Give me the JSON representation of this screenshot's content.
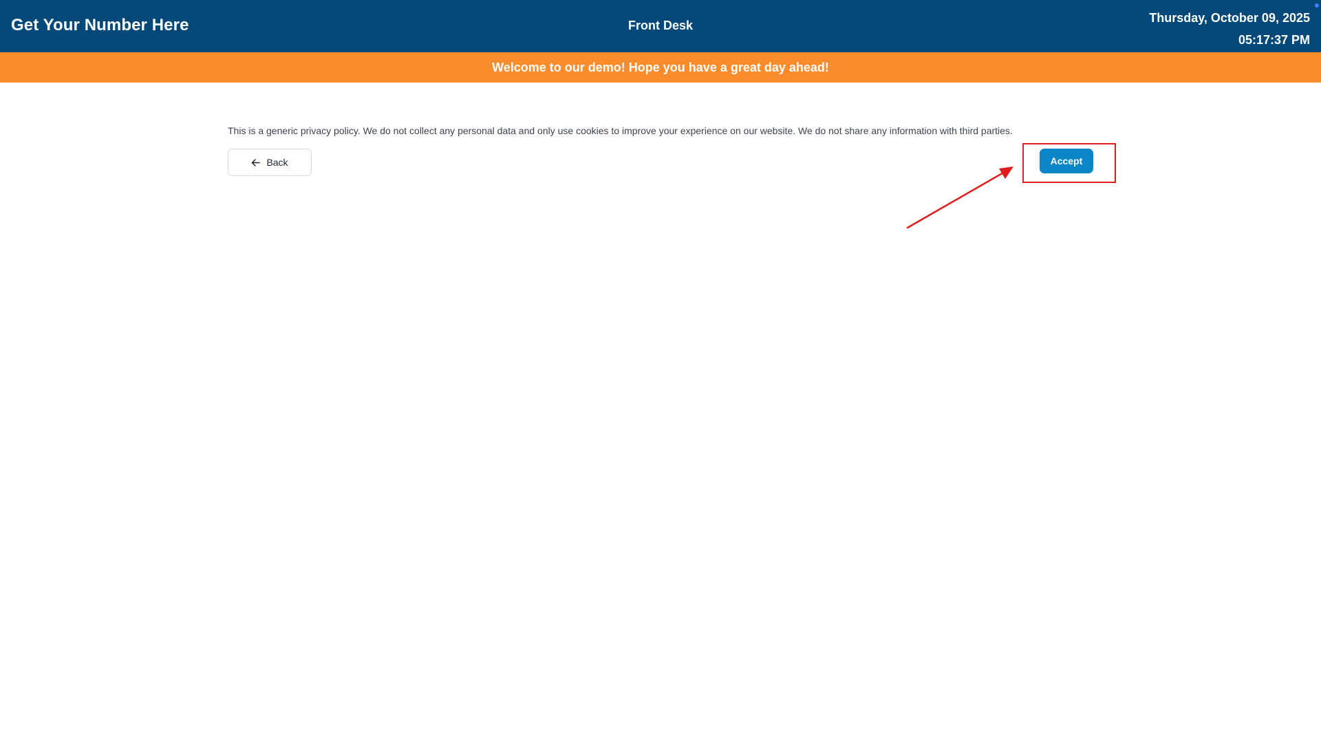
{
  "header": {
    "app_title": "Get Your Number Here",
    "location": "Front Desk",
    "date": "Thursday, October 09, 2025",
    "time": "05:17:37 PM"
  },
  "banner": {
    "message": "Welcome to our demo! Hope you have a great day ahead!"
  },
  "policy": {
    "text": "This is a generic privacy policy. We do not collect any personal data and only use cookies to improve your experience on our website. We do not share any information with third parties."
  },
  "actions": {
    "back_label": "Back",
    "back_icon": "arrow-left-icon",
    "accept_label": "Accept"
  },
  "colors": {
    "header_bg": "#02497a",
    "banner_bg": "#fb8c2c",
    "accept_bg": "#0a86c7",
    "annotation": "#e01b1b"
  }
}
